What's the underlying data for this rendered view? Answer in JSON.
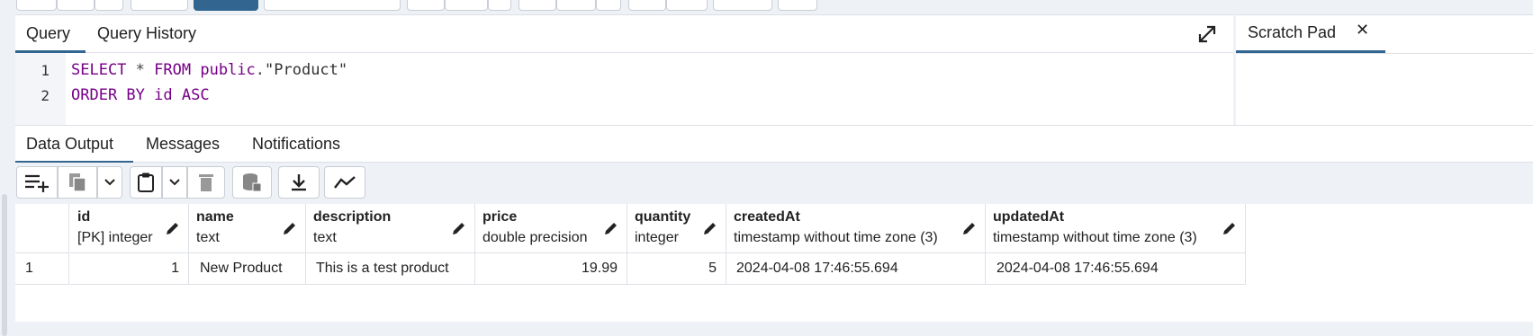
{
  "query_tabs": {
    "query": "Query",
    "history": "Query History"
  },
  "editor": {
    "lines": [
      {
        "num": "1",
        "tokens": [
          {
            "t": "SELECT",
            "c": "kw"
          },
          {
            "t": " * ",
            "c": "op"
          },
          {
            "t": "FROM",
            "c": "kw"
          },
          {
            "t": " ",
            "c": "op"
          },
          {
            "t": "public",
            "c": "kw"
          },
          {
            "t": ".",
            "c": "op"
          },
          {
            "t": "\"Product\"",
            "c": "str"
          }
        ]
      },
      {
        "num": "2",
        "tokens": [
          {
            "t": "ORDER BY",
            "c": "kw"
          },
          {
            "t": " ",
            "c": "op"
          },
          {
            "t": "id",
            "c": "kw"
          },
          {
            "t": " ",
            "c": "op"
          },
          {
            "t": "ASC",
            "c": "kw"
          }
        ]
      }
    ]
  },
  "scratch_pad": {
    "title": "Scratch Pad",
    "close": "✕"
  },
  "result_tabs": {
    "data_output": "Data Output",
    "messages": "Messages",
    "notifications": "Notifications"
  },
  "columns": [
    {
      "name": "id",
      "type": "[PK] integer"
    },
    {
      "name": "name",
      "type": "text"
    },
    {
      "name": "description",
      "type": "text"
    },
    {
      "name": "price",
      "type": "double precision"
    },
    {
      "name": "quantity",
      "type": "integer"
    },
    {
      "name": "createdAt",
      "type": "timestamp without time zone (3)"
    },
    {
      "name": "updatedAt",
      "type": "timestamp without time zone (3)"
    }
  ],
  "rows": [
    {
      "row_number": "1",
      "cells": [
        "1",
        "New Product",
        "This is a test product",
        "19.99",
        "5",
        "2024-04-08 17:46:55.694",
        "2024-04-08 17:46:55.694"
      ]
    }
  ],
  "colors": {
    "accent": "#326690",
    "keyword": "#770088"
  }
}
